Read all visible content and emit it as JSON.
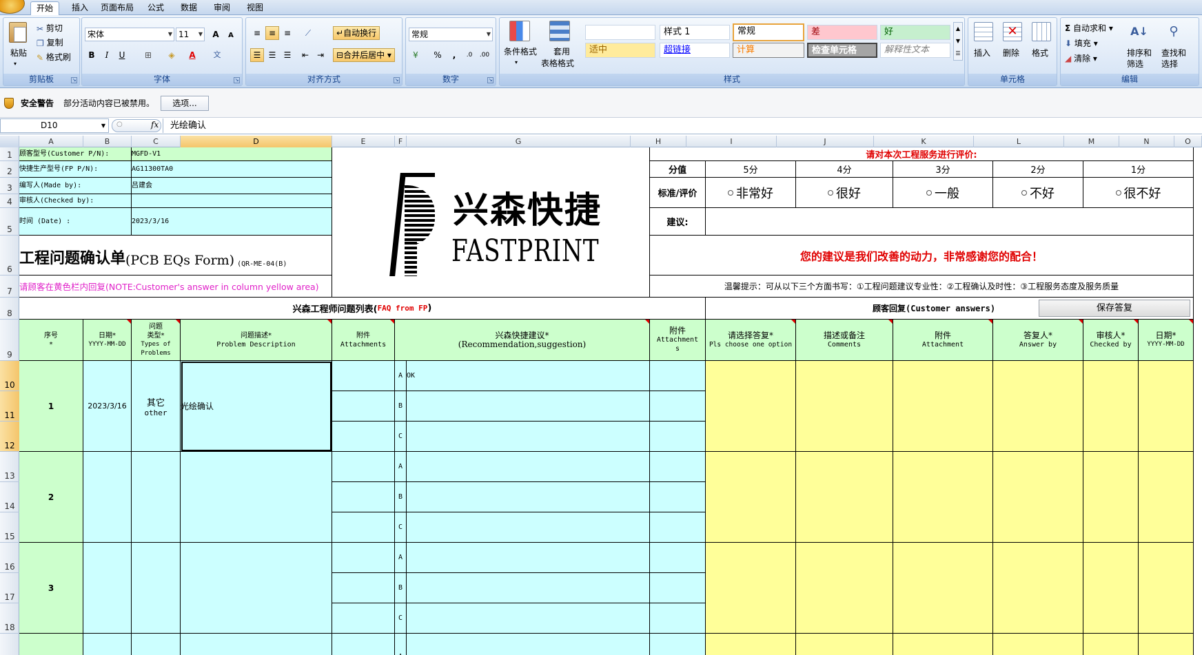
{
  "tabs": [
    "开始",
    "插入",
    "页面布局",
    "公式",
    "数据",
    "审阅",
    "视图"
  ],
  "ribbon": {
    "clipboard": {
      "paste": "粘贴",
      "cut": "剪切",
      "copy": "复制",
      "format_painter": "格式刷",
      "label": "剪贴板"
    },
    "font": {
      "name": "宋体",
      "size": "11",
      "grow": "A",
      "shrink": "A",
      "bold": "B",
      "italic": "I",
      "underline": "U",
      "font_color": "A",
      "wen": "文",
      "label": "字体"
    },
    "alignment": {
      "wrap": "自动换行",
      "merge": "合并后居中",
      "label": "对齐方式"
    },
    "number": {
      "format": "常规",
      "percent": "%",
      "comma": ",",
      "inc": ".0",
      "dec": ".00",
      "label": "数字"
    },
    "styles": {
      "conditional": "条件格式",
      "table": "套用",
      "table2": "表格格式",
      "cells": [
        "样式 1",
        "常规",
        "差",
        "好",
        "适中",
        "超链接",
        "计算",
        "检查单元格",
        "解释性文本"
      ],
      "label": "样式"
    },
    "cells": {
      "insert": "插入",
      "delete": "删除",
      "format": "格式",
      "label": "单元格"
    },
    "editing": {
      "autosum": "自动求和",
      "fill": "填充",
      "clear": "清除",
      "sort": "排序和",
      "sort2": "筛选",
      "find": "查找和",
      "find2": "选择",
      "label": "编辑"
    }
  },
  "security": {
    "title": "安全警告",
    "message": "部分活动内容已被禁用。",
    "options": "选项..."
  },
  "formula_bar": {
    "name_box": "D10",
    "fx": "fx",
    "content": "光绘确认"
  },
  "columns": [
    "A",
    "B",
    "C",
    "D",
    "E",
    "F",
    "G",
    "H",
    "I",
    "J",
    "K",
    "L",
    "M",
    "N",
    "O"
  ],
  "rows": [
    "1",
    "2",
    "3",
    "4",
    "5",
    "6",
    "7",
    "8",
    "9",
    "10",
    "11",
    "12",
    "13",
    "14",
    "15",
    "16",
    "17",
    "18"
  ],
  "sheet": {
    "customer_pn_label": "顾客型号(Customer P/N):",
    "customer_pn": "MGFD-V1",
    "fp_pn_label": "快捷生产型号(FP P/N):",
    "fp_pn": "AG11300TA0",
    "made_by_label": "编写人(Made by):",
    "made_by": "吕建会",
    "checked_by_label": "审核人(Checked by):",
    "checked_by": "",
    "date_label": "时间 (Date) :",
    "date": "2023/3/16",
    "form_title": "工程问题确认单",
    "form_title_en": "(PCB EQs Form)",
    "form_code": "(QR-ME-04(B)",
    "yellow_note": "请顾客在黄色栏内回复(NOTE:Customer's answer in column yellow area)",
    "logo_cn": "兴森快捷",
    "logo_en": "FASTPRINT",
    "rating_title": "请对本次工程服务进行评价:",
    "score_label": "分值",
    "scores": [
      "5分",
      "4分",
      "3分",
      "2分",
      "1分"
    ],
    "std_label": "标准/评价",
    "std_options": [
      "非常好",
      "很好",
      "一般",
      "不好",
      "很不好"
    ],
    "suggest_label": "建议:",
    "thanks": "您的建议是我们改善的动力，非常感谢您的配合！",
    "tip": "温馨提示：可从以下三个方面书写：①工程问题建议专业性：②工程确认及时性：③工程服务态度及服务质量",
    "faq_title": "兴森工程师问题列表(",
    "faq_en": "FAQ from FP",
    "cust_title": "顾客回复(Customer answers)",
    "save_btn": "保存答复",
    "headers": {
      "seq": "序号",
      "seq2": "*",
      "date": "日期*",
      "date2": "YYYY-MM-DD",
      "type": "问题",
      "type2": "类型*",
      "type3": "Types of",
      "type4": "Problems",
      "desc": "问题描述*",
      "desc2": "Problem Description",
      "att": "附件",
      "att2": "Attachments",
      "rec": "兴森快捷建议*",
      "rec2": "(Recommendation,suggestion)",
      "att3": "附件",
      "att4": "Attachment",
      "att5": "s",
      "choose": "请选择答复*",
      "choose2": "Pls choose one option",
      "comment": "描述或备注",
      "comment2": "Comments",
      "attach": "附件",
      "attach2": "Attachment",
      "answer": "答复人*",
      "answer2": "Answer by",
      "checker": "审核人*",
      "checker2": "Checked by",
      "date3": "日期*",
      "date4": "YYYY-MM-DD"
    },
    "items": [
      {
        "no": "1",
        "date": "2023/3/16",
        "type": "其它",
        "type_en": "other",
        "desc": "光绘确认",
        "opt_a": "OK"
      },
      {
        "no": "2",
        "date": "",
        "type": "",
        "type_en": "",
        "desc": "",
        "opt_a": ""
      },
      {
        "no": "3",
        "date": "",
        "type": "",
        "type_en": "",
        "desc": "",
        "opt_a": ""
      }
    ],
    "options": [
      "A",
      "B",
      "C"
    ]
  },
  "colors": {
    "green": "#ccffcc",
    "cyan": "#ccffff",
    "yellow": "#ffff99",
    "red": "#e00000",
    "magenta": "#e020c8"
  }
}
